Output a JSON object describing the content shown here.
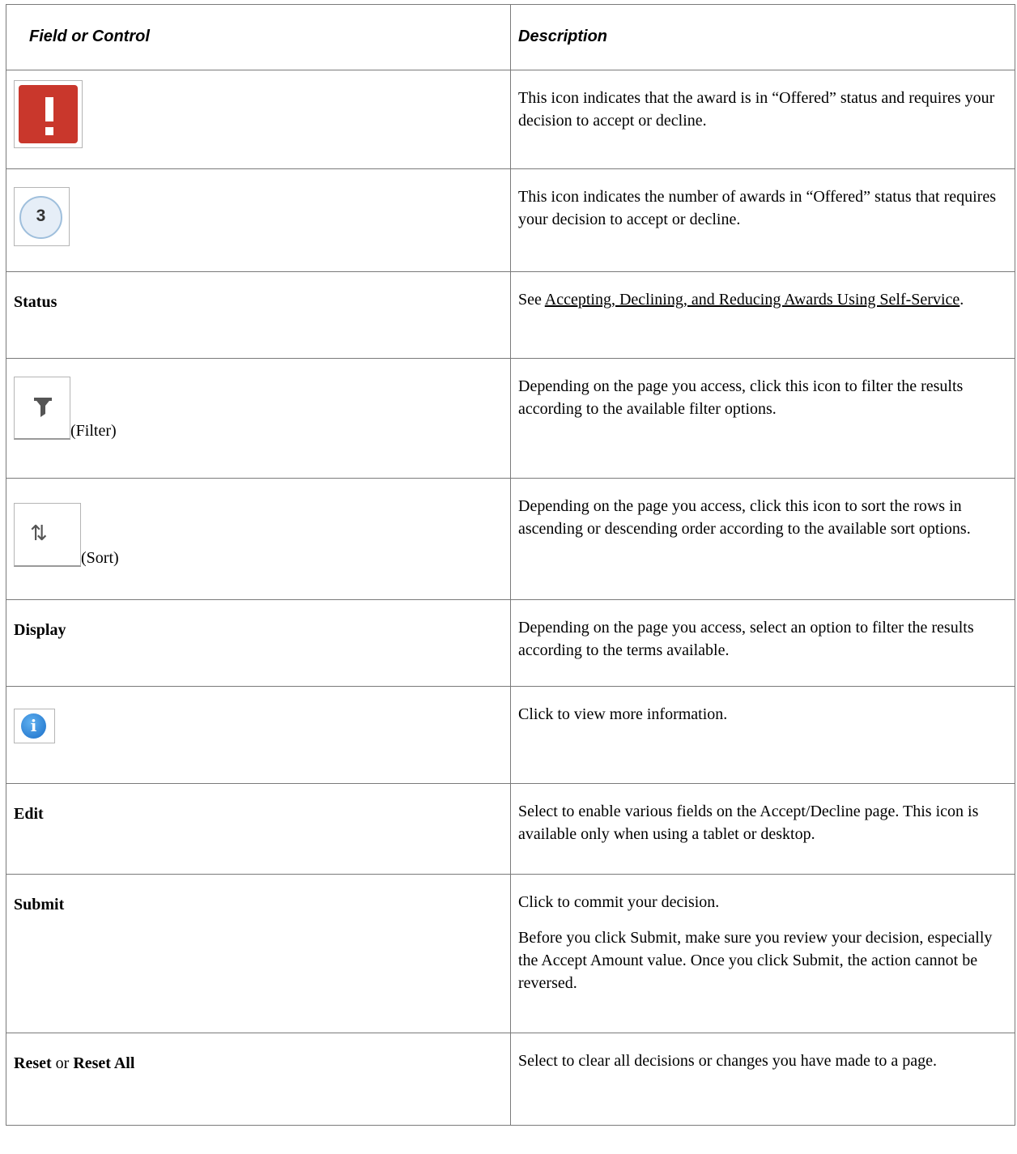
{
  "header": {
    "col1": "Field or Control",
    "col2": "Description"
  },
  "rows": [
    {
      "icon": "exclamation-icon",
      "desc": "This icon indicates that the award is in “Offered” status and requires your decision to accept or decline."
    },
    {
      "icon": "counter-badge-icon",
      "badge": "3",
      "desc": "This icon indicates the number of awards in “Offered” status that requires your decision to accept or decline."
    },
    {
      "label": "Status",
      "desc_prefix": "See ",
      "link": "Accepting, Declining, and Reducing Awards Using Self-Service",
      "desc_suffix": "."
    },
    {
      "icon": "filter-icon",
      "suffix": "(Filter)",
      "desc": "Depending on the page you access, click this icon to filter the results according to the available filter options."
    },
    {
      "icon": "sort-icon",
      "suffix": "(Sort)",
      "desc": "Depending on the page you access, click this icon to sort the rows in ascending or descending order according to the available sort options."
    },
    {
      "label": "Display",
      "desc": "Depending on the page you access, select an option to filter the results according to the terms available."
    },
    {
      "icon": "info-icon",
      "desc": "Click to view more information."
    },
    {
      "label": "Edit",
      "desc": "Select to enable various fields on the Accept/Decline page.  This icon is available only when using a tablet or desktop."
    },
    {
      "label": "Submit",
      "desc": "Click to commit your decision.",
      "desc2": "Before you click Submit, make sure you review your decision,  especially the Accept Amount value. Once you click Submit,  the action cannot be reversed."
    },
    {
      "label": "Reset",
      "label_mid": " or ",
      "label2": "Reset All",
      "desc": "Select to clear all decisions or changes you have made to a page."
    }
  ]
}
